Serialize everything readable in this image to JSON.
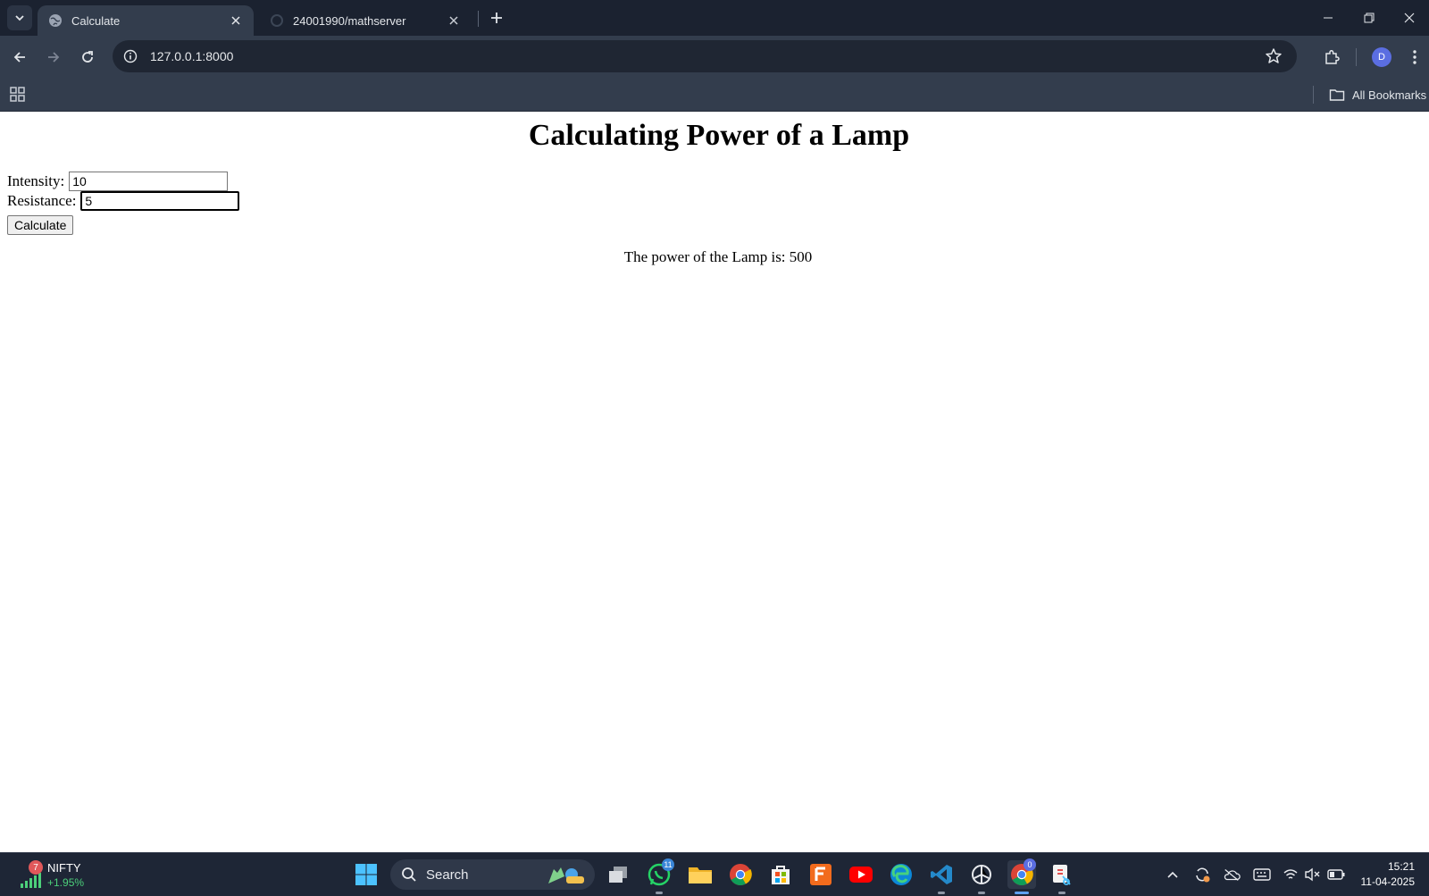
{
  "browser": {
    "tabs": [
      {
        "title": "Calculate",
        "active": true
      },
      {
        "title": "24001990/mathserver",
        "active": false
      }
    ],
    "address_bar": {
      "url": "127.0.0.1:8000"
    },
    "profile_initial": "D",
    "bookmarks_bar": {
      "all_bookmarks_label": "All Bookmarks"
    }
  },
  "page": {
    "heading": "Calculating Power of a Lamp",
    "form": {
      "intensity_label": "Intensity:",
      "intensity_value": "10",
      "resistance_label": "Resistance:",
      "resistance_value": "5",
      "submit_label": "Calculate"
    },
    "result_text": "The power of the Lamp is: 500"
  },
  "taskbar": {
    "widget": {
      "badge_count": "7",
      "name": "NIFTY",
      "change": "+1.95%"
    },
    "search_label": "Search",
    "whatsapp_badge": "11",
    "chrome_badge": "0",
    "clock": {
      "time": "15:21",
      "date": "11-04-2025"
    }
  },
  "colors": {
    "tabstrip": "#1b2230",
    "toolbar": "#333d4d",
    "taskbar": "#1e2636",
    "accent": "#5ea1f2"
  }
}
